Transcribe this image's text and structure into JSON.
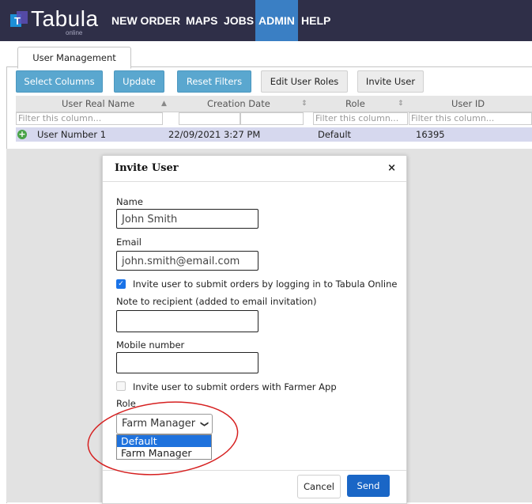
{
  "app": {
    "logo_text": "Tabula",
    "logo_sub": "online",
    "nav": [
      "NEW ORDER",
      "MAPS",
      "JOBS",
      "ADMIN",
      "HELP"
    ],
    "active_nav": "ADMIN"
  },
  "tabs": [
    "User Management"
  ],
  "toolbar": {
    "select_columns": "Select Columns",
    "update": "Update",
    "reset_filters": "Reset Filters",
    "edit_user_roles": "Edit User Roles",
    "invite_user": "Invite User"
  },
  "grid": {
    "columns": [
      "User Real Name",
      "Creation Date",
      "Role",
      "User ID"
    ],
    "filter_placeholder": "Filter this column...",
    "rows": [
      {
        "name": "User Number 1",
        "created": "22/09/2021 3:27 PM",
        "role": "Default",
        "id": "16395"
      }
    ]
  },
  "modal": {
    "title": "Invite User",
    "close_icon": "×",
    "name_label": "Name",
    "name_value": "John Smith",
    "email_label": "Email",
    "email_value": "john.smith@email.com",
    "invite_online_label": "Invite user to submit orders by logging in to Tabula Online",
    "invite_online_checked": true,
    "note_label": "Note to recipient (added to email invitation)",
    "note_value": "",
    "mobile_label": "Mobile number",
    "mobile_value": "",
    "invite_app_label": "Invite user to submit orders with Farmer App",
    "invite_app_checked": false,
    "role_label": "Role",
    "role_selected": "Farm Manager",
    "role_options": [
      "Default",
      "Farm Manager"
    ],
    "role_highlighted": "Default",
    "cancel": "Cancel",
    "send": "Send"
  },
  "colors": {
    "nav_bg": "#2f2f48",
    "nav_active": "#3a7fc4",
    "toolbar_blue": "#5aa7cf",
    "send_blue": "#1a66c6",
    "row_highlight": "#d6d8ee",
    "annotation": "#d62020"
  }
}
